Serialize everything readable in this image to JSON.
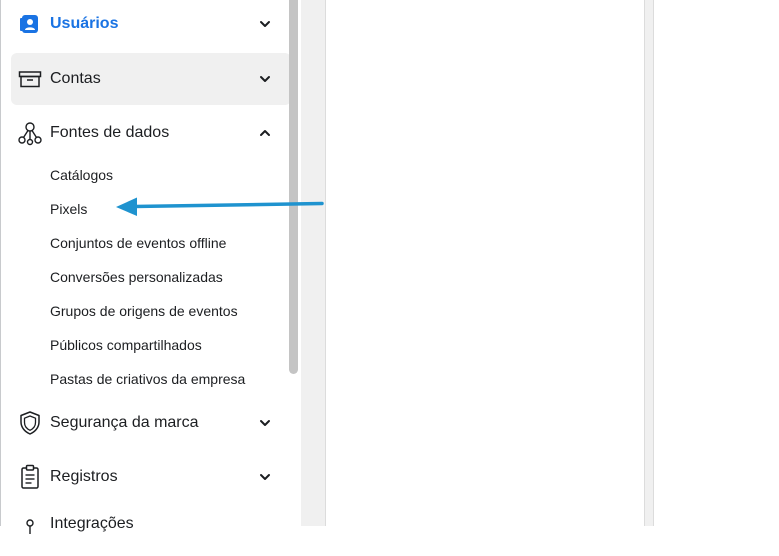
{
  "sidebar": {
    "items": [
      {
        "label": "Usuários",
        "icon": "user-badge-icon",
        "expanded": false,
        "active": true
      },
      {
        "label": "Contas",
        "icon": "archive-box-icon",
        "expanded": false
      },
      {
        "label": "Fontes de dados",
        "icon": "data-sources-icon",
        "expanded": true
      },
      {
        "label": "Segurança da marca",
        "icon": "shield-icon",
        "expanded": false
      },
      {
        "label": "Registros",
        "icon": "clipboard-icon",
        "expanded": false
      },
      {
        "label": "Integrações",
        "icon": "integrations-icon",
        "expanded": false
      }
    ],
    "subitems": [
      {
        "label": "Catálogos"
      },
      {
        "label": "Pixels"
      },
      {
        "label": "Conjuntos de eventos offline"
      },
      {
        "label": "Conversões personalizadas"
      },
      {
        "label": "Grupos de origens de eventos"
      },
      {
        "label": "Públicos compartilhados"
      },
      {
        "label": "Pastas de criativos da empresa"
      }
    ]
  },
  "colors": {
    "accent": "#1a73e3",
    "annotation_arrow": "#1f93cf",
    "highlight": "#f0f0f0"
  }
}
